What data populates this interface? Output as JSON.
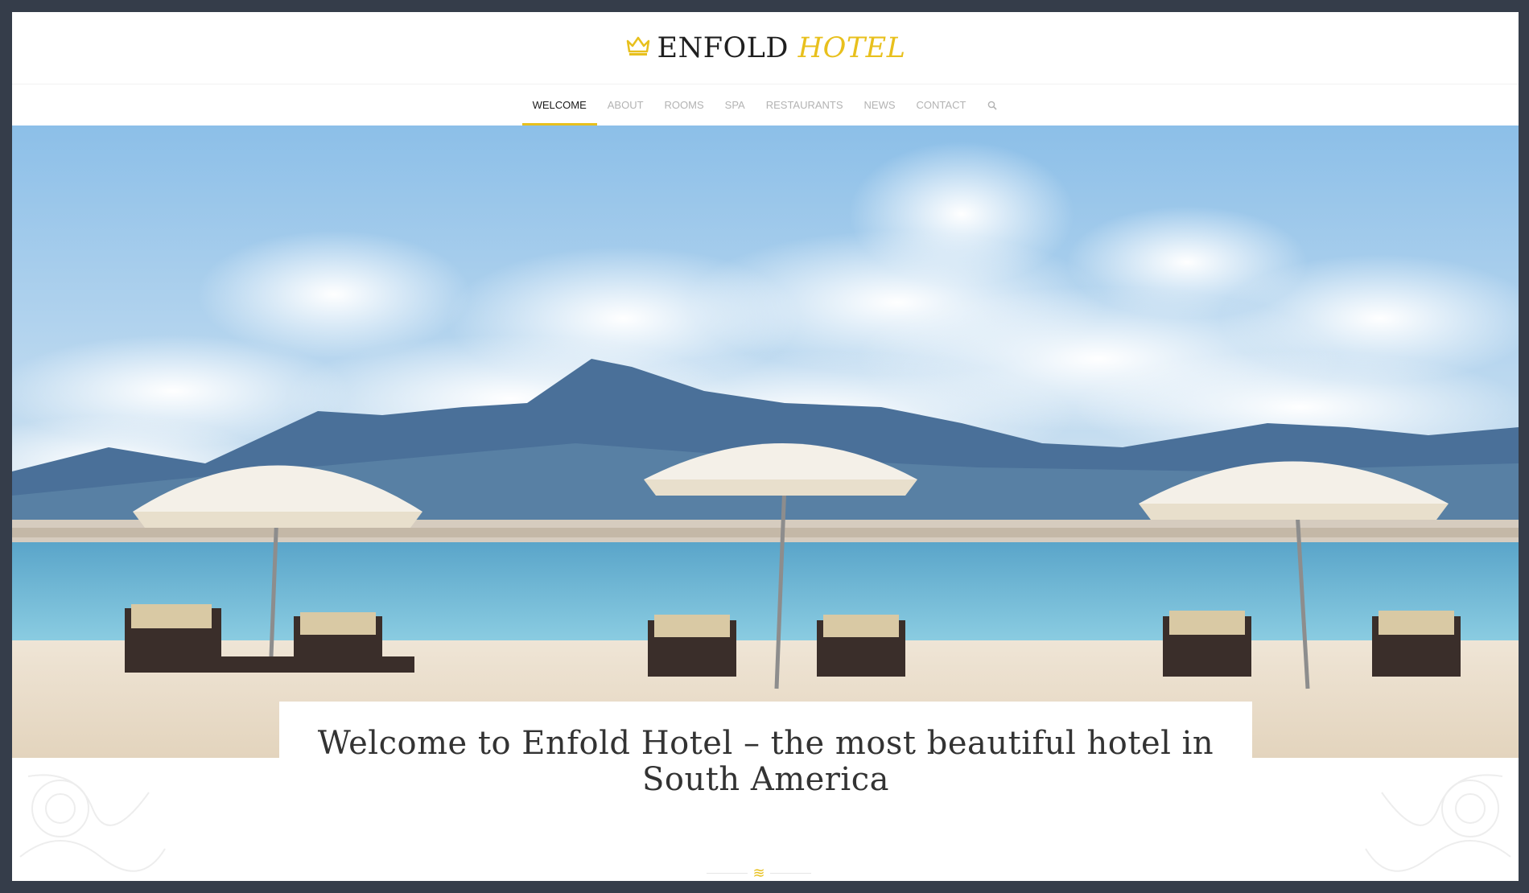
{
  "brand": {
    "name": "ENFOLD",
    "accent": "HOTEL",
    "logo_icon": "crown-icon",
    "accent_color": "#e8c01d"
  },
  "nav": {
    "items": [
      {
        "label": "WELCOME",
        "active": true
      },
      {
        "label": "ABOUT",
        "active": false
      },
      {
        "label": "ROOMS",
        "active": false
      },
      {
        "label": "SPA",
        "active": false
      },
      {
        "label": "RESTAURANTS",
        "active": false
      },
      {
        "label": "NEWS",
        "active": false
      },
      {
        "label": "CONTACT",
        "active": false
      }
    ],
    "search_icon": "search-icon"
  },
  "hero": {
    "image": "beach-umbrellas-photo"
  },
  "welcome": {
    "title": "Welcome to Enfold Hotel – the most beautiful hotel in South America"
  },
  "divider": {
    "icon": "wave-icon",
    "glyph": "≋"
  },
  "colors": {
    "page_frame": "#353d4a",
    "nav_active": "#1a1a1a",
    "nav_inactive": "#b3b3b3"
  }
}
